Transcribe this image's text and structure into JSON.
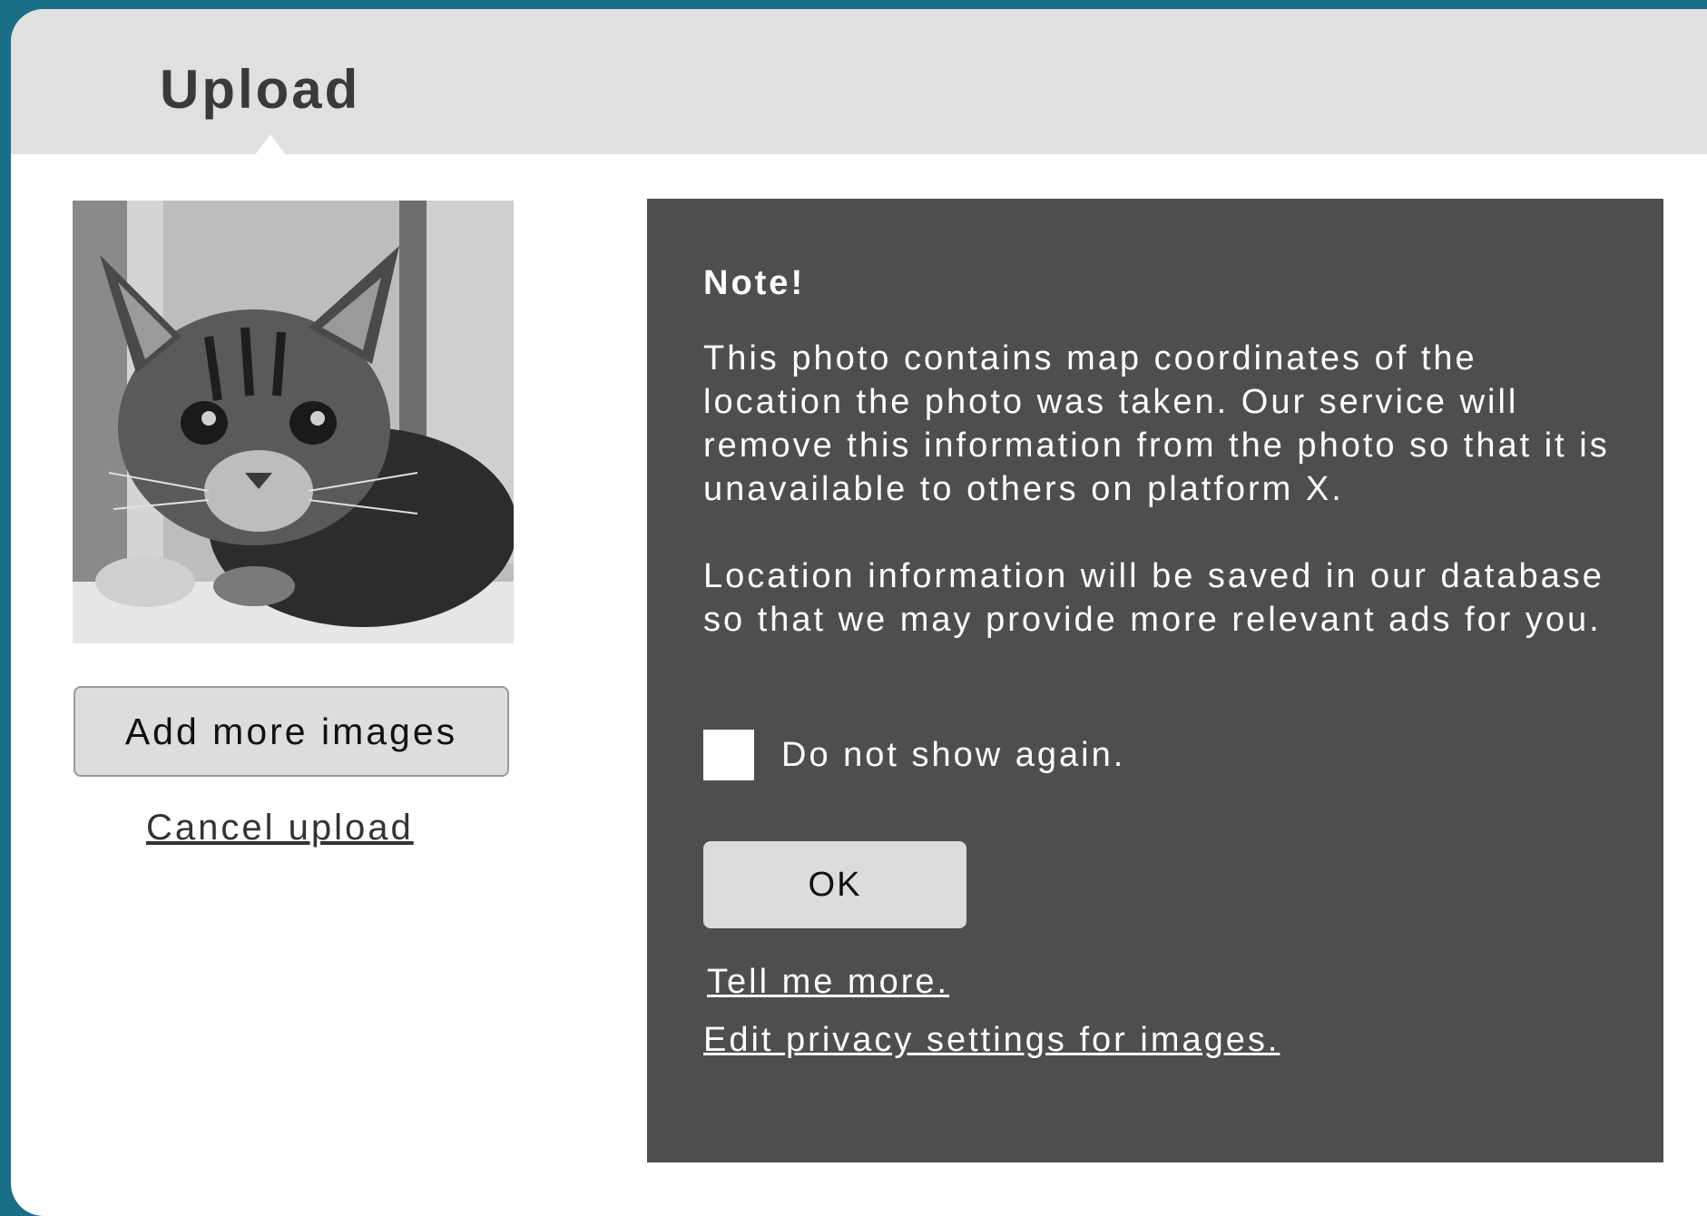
{
  "dialog": {
    "title": "Upload"
  },
  "left": {
    "thumbnail_icon": "cat-photo",
    "add_button": "Add more images",
    "cancel_link": "Cancel upload"
  },
  "note": {
    "title": "Note!",
    "paragraph1": "This photo contains map coordinates of the location the photo was taken. Our service will remove this information from the photo so that it is unavailable to others on platform X.",
    "paragraph2": "Location information will be saved in our database so that we may provide more relevant ads for you.",
    "checkbox_label": "Do not show again.",
    "checkbox_checked": false,
    "ok_button": "OK",
    "link_more": "Tell me more.",
    "link_privacy": "Edit privacy settings for images."
  },
  "colors": {
    "background": "#1b6e88",
    "header": "#e0e0e0",
    "note_panel": "#4e4e4e",
    "button": "#dddddd"
  }
}
